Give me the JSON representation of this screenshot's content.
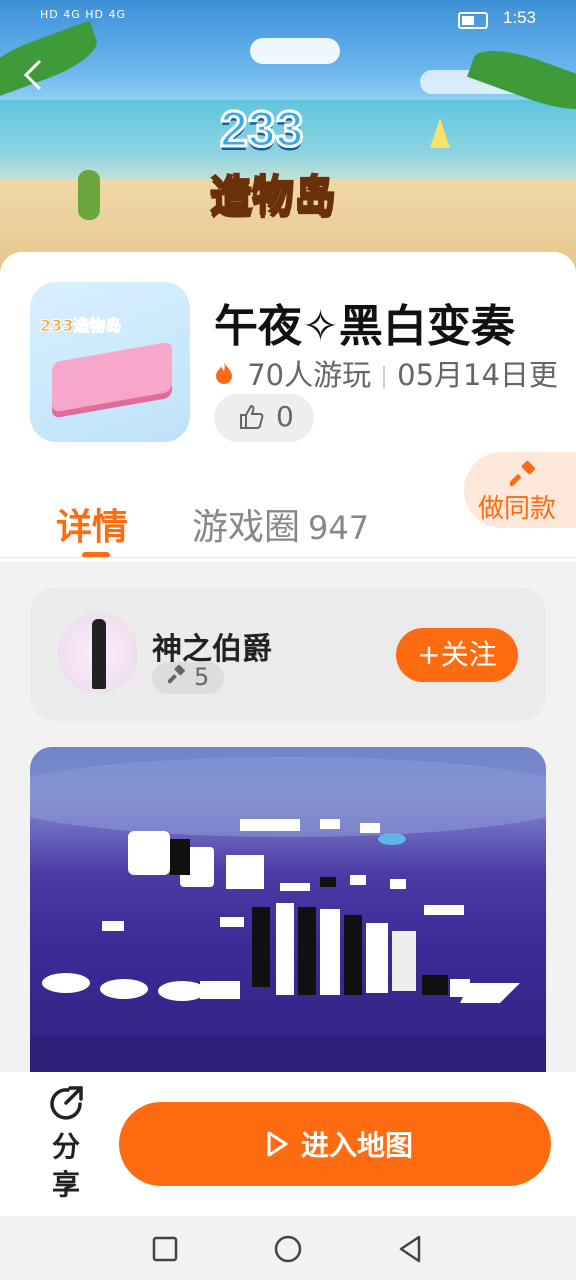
{
  "status_bar": {
    "network": "HD 4G HD 4G",
    "time": "1:53"
  },
  "banner": {
    "logo_number": "233",
    "logo_text": "造物岛"
  },
  "game": {
    "title": "午夜✧黑白变奏",
    "players": "70人游玩",
    "updated": "05月14日更",
    "likes": "0",
    "thumb_label": "233造物岛"
  },
  "tabs": [
    {
      "label": "详情"
    },
    {
      "label": "游戏圈",
      "count": "947"
    }
  ],
  "make_same": {
    "label": "做同款"
  },
  "author": {
    "name": "神之伯爵",
    "works": "5",
    "follow_label": "+关注"
  },
  "bottom": {
    "share_label": "分享",
    "enter_label": "进入地图"
  },
  "colors": {
    "accent": "#ff6b10"
  }
}
